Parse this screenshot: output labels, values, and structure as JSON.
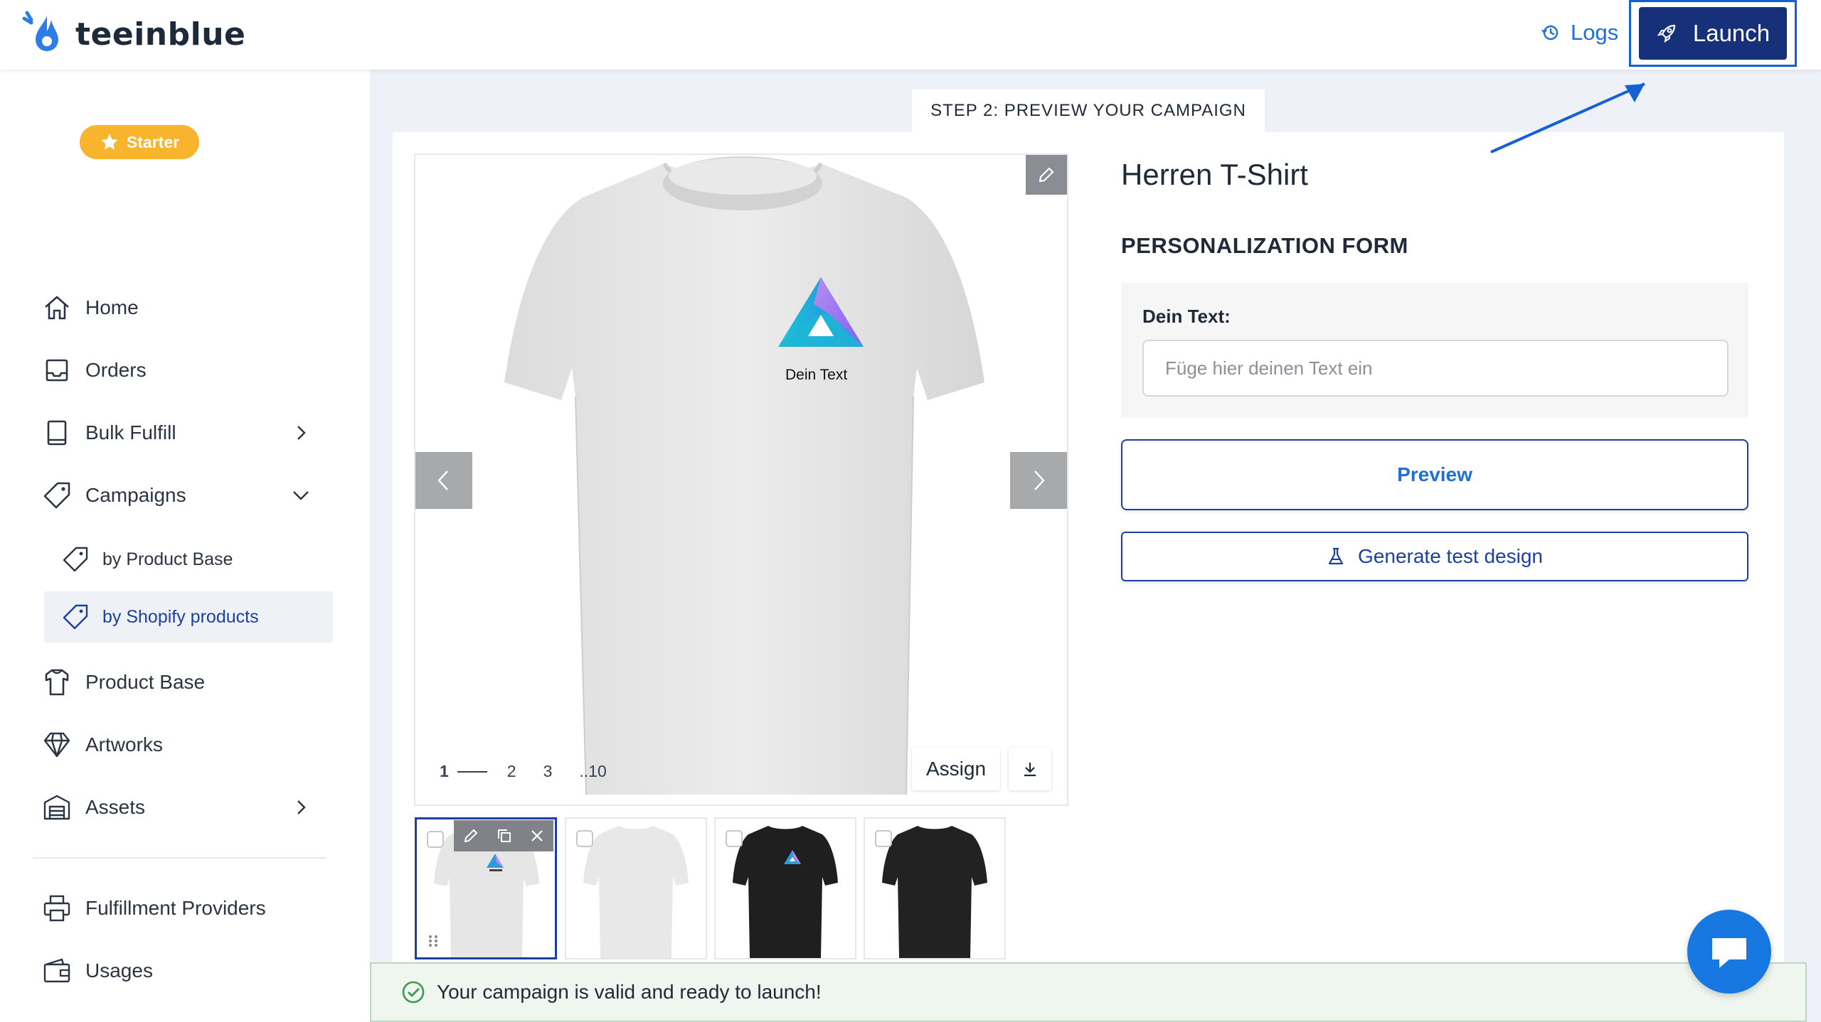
{
  "brand": {
    "name": "teeinblue"
  },
  "header": {
    "logs_label": "Logs",
    "launch_label": "Launch"
  },
  "sidebar": {
    "plan_badge": "Starter",
    "items": [
      {
        "label": "Home",
        "icon": "home-icon"
      },
      {
        "label": "Orders",
        "icon": "inbox-icon"
      },
      {
        "label": "Bulk Fulfill",
        "icon": "book-icon"
      },
      {
        "label": "Campaigns",
        "icon": "tag-icon"
      },
      {
        "label": "Product Base",
        "icon": "shirt-icon"
      },
      {
        "label": "Artworks",
        "icon": "diamond-icon"
      },
      {
        "label": "Assets",
        "icon": "warehouse-icon"
      },
      {
        "label": "Fulfillment Providers",
        "icon": "printer-icon"
      },
      {
        "label": "Usages",
        "icon": "wallet-icon"
      }
    ],
    "campaign_sub": [
      {
        "label": "by Product Base"
      },
      {
        "label": "by Shopify products"
      }
    ]
  },
  "main": {
    "step_label": "STEP 2: PREVIEW YOUR CAMPAIGN",
    "mockup_text": "Dein Text",
    "pager": {
      "current": "1",
      "p2": "2",
      "p3": "3",
      "last": "..10"
    },
    "assign_label": "Assign",
    "product_title": "Herren T-Shirt",
    "form_title": "PERSONALIZATION FORM",
    "field_label": "Dein Text:",
    "field_placeholder": "Füge hier deinen Text ein",
    "preview_label": "Preview",
    "generate_label": "Generate test design"
  },
  "status": {
    "message": "Your campaign is valid and ready to launch!"
  },
  "colors": {
    "accent": "#17307a",
    "link": "#1f6fd6",
    "badge": "#f7b42c",
    "success_bg": "#eef6ef",
    "chat": "#1678e0"
  }
}
